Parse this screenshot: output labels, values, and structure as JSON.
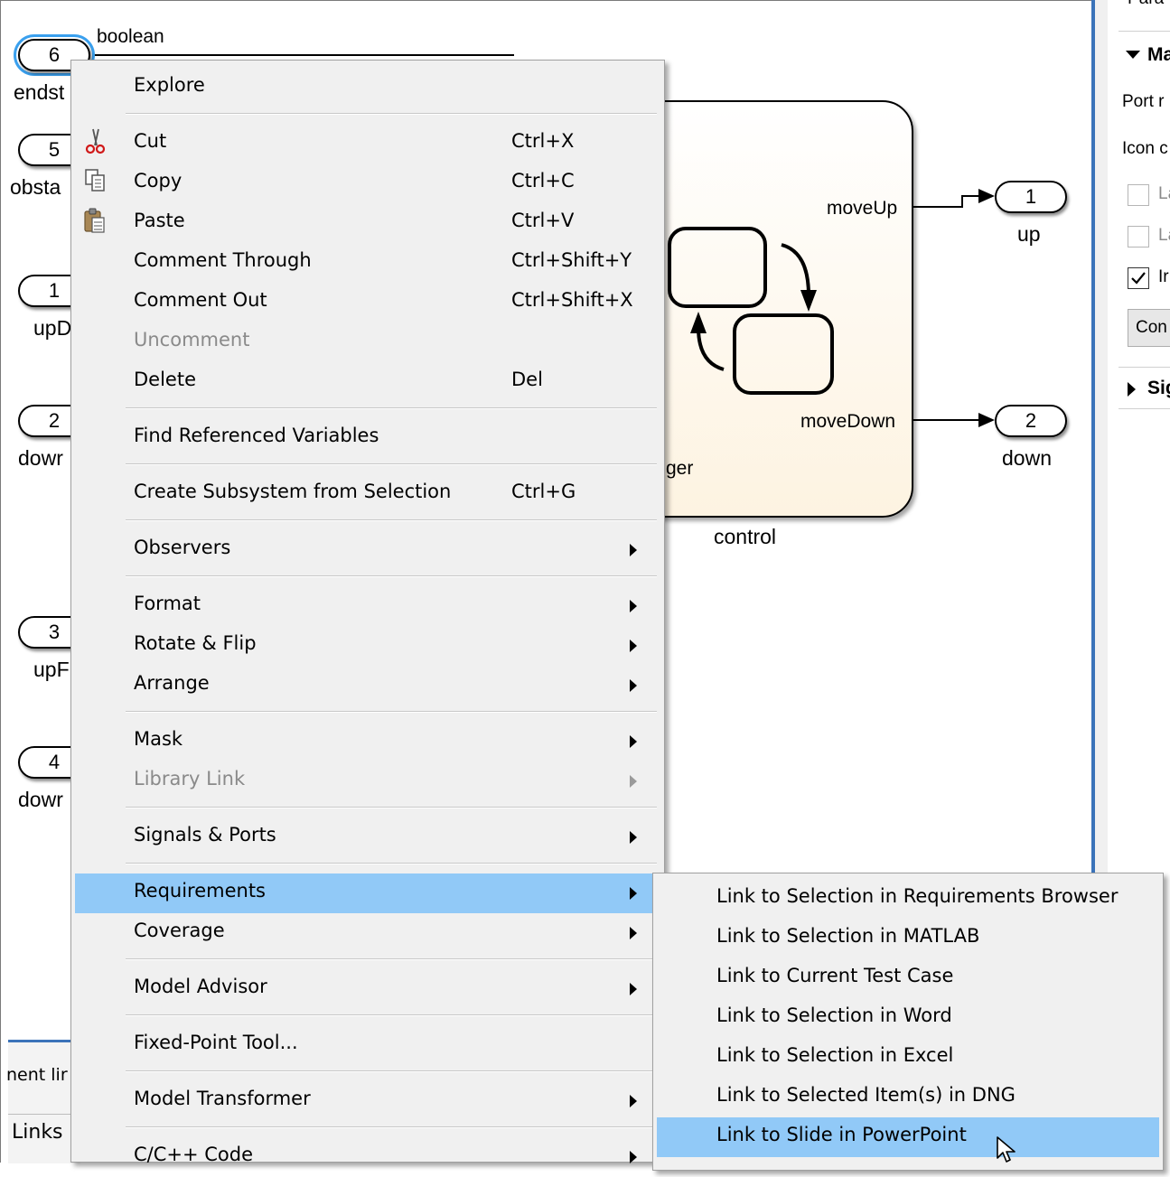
{
  "canvas": {
    "ports_left": [
      {
        "number": "6",
        "label": "endst"
      },
      {
        "number": "5",
        "label": "obsta"
      },
      {
        "number": "1",
        "label": "upD"
      },
      {
        "number": "2",
        "label": "dowr"
      },
      {
        "number": "3",
        "label": "upF"
      },
      {
        "number": "4",
        "label": "dowr"
      }
    ],
    "signal_label": "boolean",
    "chart": {
      "name": "control",
      "output_up": "moveUp",
      "output_down": "moveDown",
      "partial_text": "ger"
    },
    "ports_right": [
      {
        "number": "1",
        "label": "up"
      },
      {
        "number": "2",
        "label": "down"
      }
    ],
    "bottom_panel": {
      "text": "nent lir",
      "tab_label": "Links"
    }
  },
  "right_panel": {
    "top_text": "Para",
    "section_mask": "Ma",
    "port_label": "Port r",
    "icon_label": "Icon c",
    "check1_label": "La",
    "check2_label": "La",
    "check3_label": "Ir",
    "button_label": "Con",
    "section_signal": "Sig"
  },
  "context_menu": {
    "items": [
      {
        "label": "Explore",
        "shortcut": ""
      },
      {
        "label": "Cut",
        "shortcut": "Ctrl+X",
        "icon": "scissors-icon"
      },
      {
        "label": "Copy",
        "shortcut": "Ctrl+C",
        "icon": "copy-icon"
      },
      {
        "label": "Paste",
        "shortcut": "Ctrl+V",
        "icon": "paste-icon"
      },
      {
        "label": "Comment Through",
        "shortcut": "Ctrl+Shift+Y"
      },
      {
        "label": "Comment Out",
        "shortcut": "Ctrl+Shift+X"
      },
      {
        "label": "Uncomment",
        "shortcut": "",
        "disabled": true
      },
      {
        "label": "Delete",
        "shortcut": "Del"
      },
      {
        "label": "Find Referenced Variables",
        "shortcut": ""
      },
      {
        "label": "Create Subsystem from Selection",
        "shortcut": "Ctrl+G"
      },
      {
        "label": "Observers",
        "submenu": true
      },
      {
        "label": "Format",
        "submenu": true
      },
      {
        "label": "Rotate & Flip",
        "submenu": true
      },
      {
        "label": "Arrange",
        "submenu": true
      },
      {
        "label": "Mask",
        "submenu": true
      },
      {
        "label": "Library Link",
        "submenu": true,
        "disabled": true
      },
      {
        "label": "Signals & Ports",
        "submenu": true
      },
      {
        "label": "Requirements",
        "submenu": true,
        "highlighted": true
      },
      {
        "label": "Coverage",
        "submenu": true
      },
      {
        "label": "Model Advisor",
        "submenu": true
      },
      {
        "label": "Fixed-Point Tool...",
        "submenu": false
      },
      {
        "label": "Model Transformer",
        "submenu": true
      },
      {
        "label": "C/C++ Code",
        "submenu": true
      }
    ]
  },
  "requirements_submenu": {
    "items": [
      {
        "label": "Link to Selection in Requirements Browser"
      },
      {
        "label": "Link to Selection in MATLAB"
      },
      {
        "label": "Link to Current Test Case"
      },
      {
        "label": "Link to Selection in Word"
      },
      {
        "label": "Link to Selection in Excel"
      },
      {
        "label": "Link to Selected Item(s) in DNG"
      },
      {
        "label": "Link to Slide in PowerPoint",
        "highlighted": true
      }
    ]
  },
  "colors": {
    "menu_bg": "#f0f0f0",
    "menu_highlight": "#91c9f7",
    "splitter": "#3b73b9",
    "chart_fill": "#fdf3e1",
    "selected_port_outline": "#3aa0ee"
  }
}
